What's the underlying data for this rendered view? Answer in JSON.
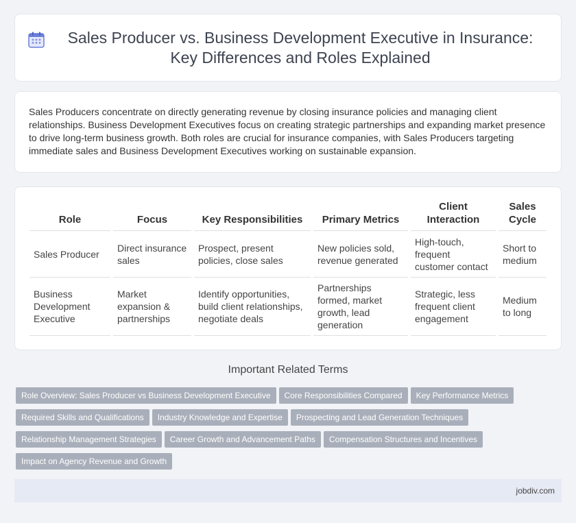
{
  "header": {
    "icon": "calendar-icon",
    "title": "Sales Producer vs. Business Development Executive in Insurance: Key Differences and Roles Explained"
  },
  "intro": {
    "text": "Sales Producers concentrate on directly generating revenue by closing insurance policies and managing client relationships. Business Development Executives focus on creating strategic partnerships and expanding market presence to drive long-term business growth. Both roles are crucial for insurance companies, with Sales Producers targeting immediate sales and Business Development Executives working on sustainable expansion."
  },
  "table": {
    "headers": [
      "Role",
      "Focus",
      "Key Responsibilities",
      "Primary Metrics",
      "Client Interaction",
      "Sales Cycle"
    ],
    "rows": [
      [
        "Sales Producer",
        "Direct insurance sales",
        "Prospect, present policies, close sales",
        "New policies sold, revenue generated",
        "High-touch, frequent customer contact",
        "Short to medium"
      ],
      [
        "Business Development Executive",
        "Market expansion & partnerships",
        "Identify opportunities, build client relationships, negotiate deals",
        "Partnerships formed, market growth, lead generation",
        "Strategic, less frequent client engagement",
        "Medium to long"
      ]
    ]
  },
  "related": {
    "title": "Important Related Terms",
    "tags": [
      "Role Overview: Sales Producer vs Business Development Executive",
      "Core Responsibilities Compared",
      "Key Performance Metrics",
      "Required Skills and Qualifications",
      "Industry Knowledge and Expertise",
      "Prospecting and Lead Generation Techniques",
      "Relationship Management Strategies",
      "Career Growth and Advancement Paths",
      "Compensation Structures and Incentives",
      "Impact on Agency Revenue and Growth"
    ]
  },
  "footer": {
    "site": "jobdiv.com"
  },
  "colors": {
    "tag_bg": "#a9afba",
    "footer_bg": "#e6eaf4",
    "page_bg": "#f1f3f7",
    "icon_accent": "#6a7fd8"
  }
}
